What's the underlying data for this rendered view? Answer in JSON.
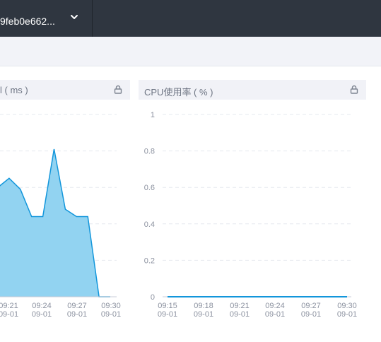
{
  "topbar": {
    "instance_id": "9feb0e662...",
    "dropdown_icon": "chevron-down-icon"
  },
  "panels": [
    {
      "title": "l ( ms )",
      "lock_icon": "lock-icon"
    },
    {
      "title": "CPU使用率 ( % )",
      "lock_icon": "lock-icon"
    }
  ],
  "chart_data": [
    {
      "type": "area",
      "title": "l ( ms )",
      "x": [
        "09:21\n09-01",
        "09:24\n09-01",
        "09:27\n09-01",
        "09:30\n09-01"
      ],
      "x_tick_labels": [
        {
          "time": "09:21",
          "date": "09-01"
        },
        {
          "time": "09:24",
          "date": "09-01"
        },
        {
          "time": "09:27",
          "date": "09-01"
        },
        {
          "time": "09:30",
          "date": "09-01"
        }
      ],
      "series_points": [
        {
          "t": 0.0,
          "v": 0.6
        },
        {
          "t": 0.5,
          "v": 0.65
        },
        {
          "t": 1.0,
          "v": 0.59
        },
        {
          "t": 1.5,
          "v": 0.44
        },
        {
          "t": 2.0,
          "v": 0.44
        },
        {
          "t": 2.5,
          "v": 0.81
        },
        {
          "t": 3.0,
          "v": 0.48
        },
        {
          "t": 3.5,
          "v": 0.44
        },
        {
          "t": 4.0,
          "v": 0.44
        },
        {
          "t": 4.5,
          "v": 0.0
        },
        {
          "t": 5.0,
          "v": 0.0
        }
      ],
      "ylim": [
        0,
        1
      ],
      "grid": true,
      "color": "#1296db",
      "fill": "#92d3f1"
    },
    {
      "type": "line",
      "title": "CPU使用率 ( % )",
      "x_tick_labels": [
        {
          "time": "09:15",
          "date": "09-01"
        },
        {
          "time": "09:18",
          "date": "09-01"
        },
        {
          "time": "09:21",
          "date": "09-01"
        },
        {
          "time": "09:24",
          "date": "09-01"
        },
        {
          "time": "09:27",
          "date": "09-01"
        },
        {
          "time": "09:30",
          "date": "09-01"
        }
      ],
      "y_ticks": [
        "1",
        "0.8",
        "0.6",
        "0.4",
        "0.2",
        "0"
      ],
      "values": [
        0,
        0,
        0,
        0,
        0,
        0
      ],
      "ylim": [
        0,
        1
      ],
      "grid": true,
      "color": "#1296db"
    }
  ]
}
